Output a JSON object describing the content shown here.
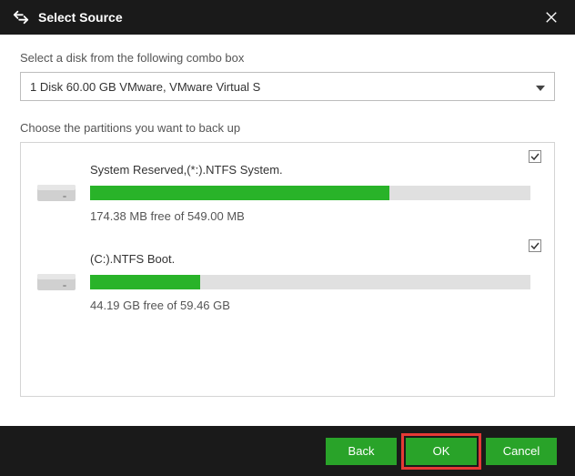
{
  "titlebar": {
    "title": "Select Source"
  },
  "labels": {
    "select_disk": "Select a disk from the following combo box",
    "choose_partitions": "Choose the partitions you want to back up"
  },
  "combo": {
    "selected": "1 Disk 60.00 GB VMware,  VMware Virtual S"
  },
  "partitions": [
    {
      "name": "System Reserved,(*:).NTFS System.",
      "free_text": "174.38 MB free of 549.00 MB",
      "fill_percent": 68,
      "checked": true
    },
    {
      "name": "(C:).NTFS Boot.",
      "free_text": "44.19 GB free of 59.46 GB",
      "fill_percent": 25,
      "checked": true
    }
  ],
  "footer": {
    "back": "Back",
    "ok": "OK",
    "cancel": "Cancel"
  }
}
